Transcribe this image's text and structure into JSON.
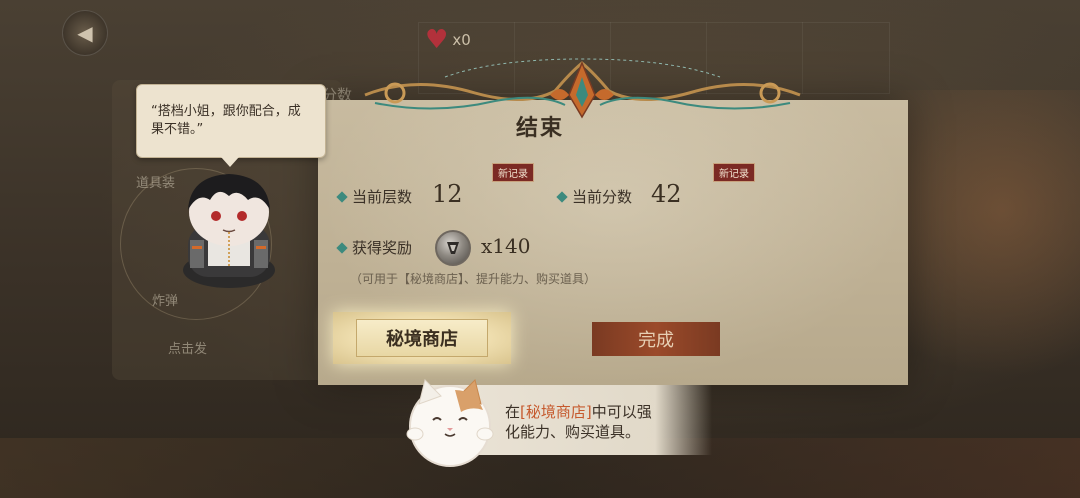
{
  "background": {
    "hearts_count": "x0",
    "score_label_partial": "分数",
    "item_label_partial": "道具装",
    "skill_label_partial": "炸弹",
    "tap_hint_partial": "点击发"
  },
  "result_panel": {
    "title": "结束",
    "current_floor_label": "当前层数",
    "current_floor_value": "12",
    "current_score_label": "当前分数",
    "current_score_value": "42",
    "new_record_badge": "新记录",
    "reward_label": "获得奖励",
    "reward_amount": "x140",
    "note": "（可用于【秘境商店】、提升能力、购买道具）",
    "shop_button": "秘境商店",
    "done_button": "完成"
  },
  "companion": {
    "speech": "“搭档小姐，跟你配合，成果不错。”"
  },
  "tip": {
    "prefix": "在",
    "highlight": "[秘境商店]",
    "suffix": "中可以强化能力、购买道具。"
  },
  "colors": {
    "accent_teal": "#3c8a7e",
    "badge_red": "#7b2a24",
    "done_button": "#9b4a2a",
    "highlight_orange": "#c65a2e"
  },
  "icons": [
    "back-icon",
    "heart-icon",
    "reward-token-icon",
    "diamond-bullet-icon"
  ]
}
